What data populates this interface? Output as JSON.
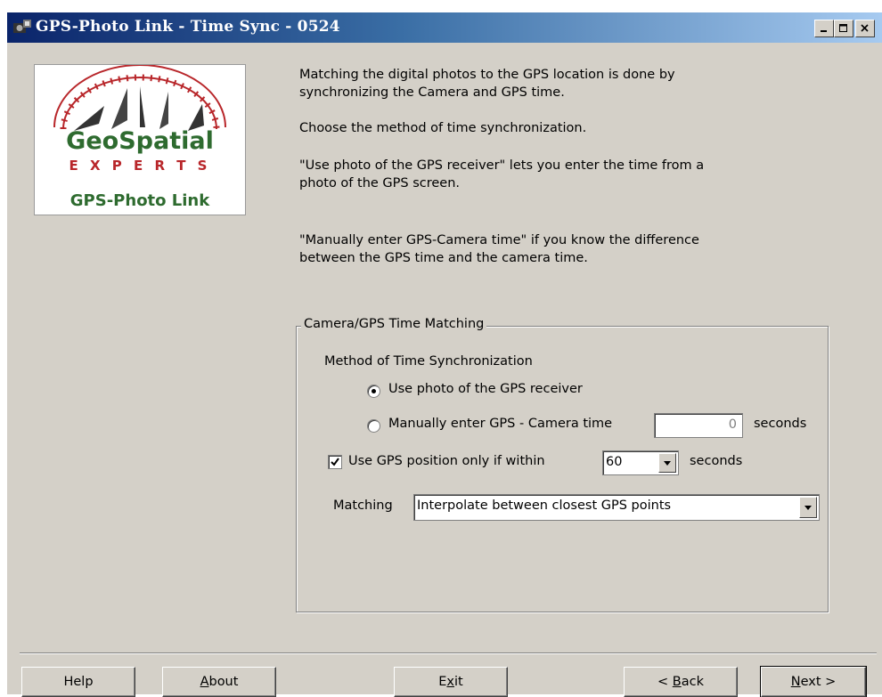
{
  "window": {
    "title": "GPS-Photo Link  - Time Sync - 0524",
    "controls": [
      "minimize",
      "maximize",
      "close"
    ]
  },
  "logo": {
    "line1": "GeoSpatial",
    "line2": "E X P E R T S",
    "line3": "GPS-Photo Link"
  },
  "description": {
    "p1": "Matching the digital photos to the GPS location is done by\nsynchronizing the Camera and GPS time.",
    "p2": "Choose the method of time synchronization.",
    "p3": "\"Use photo of the GPS receiver\" lets you enter the time from a\nphoto of the GPS screen.",
    "p4": "\"Manually enter GPS-Camera time\" if you know the difference\nbetween the GPS time and the camera time."
  },
  "group": {
    "legend": "Camera/GPS Time Matching",
    "method_label": "Method of Time Synchronization",
    "option_photo": "Use photo of the GPS receiver",
    "option_manual": "Manually enter GPS - Camera time",
    "selected_option": "photo",
    "manual_value": "0",
    "manual_unit": "seconds",
    "within_checkbox_label": "Use GPS position only if within",
    "within_checked": true,
    "within_value": "60",
    "within_unit": "seconds",
    "matching_label": "Matching",
    "matching_value": "Interpolate between closest GPS points"
  },
  "buttons": {
    "help": "Help",
    "about_pre": "",
    "about_ul": "A",
    "about_post": "bout",
    "exit_pre": "E",
    "exit_ul": "x",
    "exit_post": "it",
    "back_pre": "< ",
    "back_ul": "B",
    "back_post": "ack",
    "next_pre": "",
    "next_ul": "N",
    "next_post": "ext >"
  },
  "colors": {
    "titlebar_start": "#0a246a",
    "titlebar_end": "#a6caf0",
    "face": "#d4d0c8",
    "logo_green": "#2e6b2f",
    "logo_red": "#b8262a"
  }
}
